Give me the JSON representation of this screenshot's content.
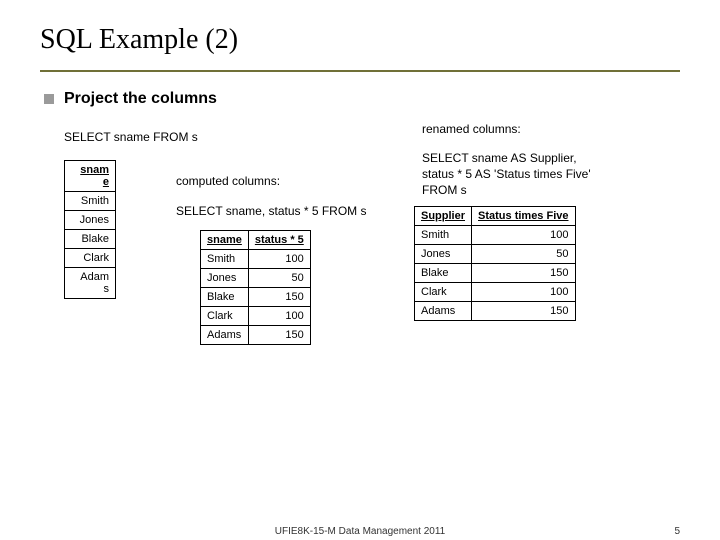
{
  "title": "SQL Example (2)",
  "bullet": "Project the columns",
  "labels": {
    "select1": "SELECT sname FROM s",
    "renamed": "renamed columns:",
    "select_renamed": "SELECT sname AS Supplier,\nstatus * 5 AS 'Status times Five'\nFROM s",
    "computed": "computed columns:",
    "select_computed": "SELECT sname, status * 5 FROM s"
  },
  "table_snam": {
    "header": "snam\ne",
    "rows": [
      "Smith",
      "Jones",
      "Blake",
      "Clark",
      "Adam\ns"
    ]
  },
  "table_computed": {
    "h1": "sname",
    "h2": "status * 5",
    "rows": [
      {
        "n": "Smith",
        "v": "100"
      },
      {
        "n": "Jones",
        "v": "50"
      },
      {
        "n": "Blake",
        "v": "150"
      },
      {
        "n": "Clark",
        "v": "100"
      },
      {
        "n": "Adams",
        "v": "150"
      }
    ]
  },
  "table_renamed": {
    "h1": "Supplier",
    "h2": "Status times Five",
    "rows": [
      {
        "n": "Smith",
        "v": "100"
      },
      {
        "n": "Jones",
        "v": "50"
      },
      {
        "n": "Blake",
        "v": "150"
      },
      {
        "n": "Clark",
        "v": "100"
      },
      {
        "n": "Adams",
        "v": "150"
      }
    ]
  },
  "footer": {
    "center": "UFIE8K-15-M Data Management 2011",
    "page": "5"
  }
}
